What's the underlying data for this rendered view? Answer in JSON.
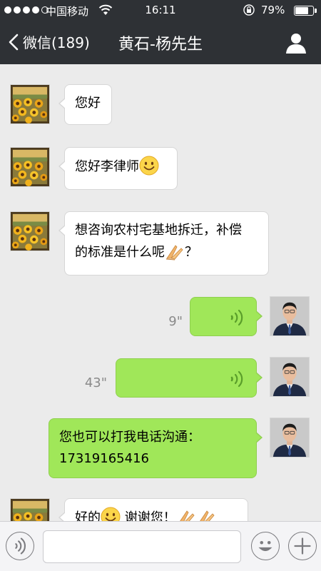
{
  "status_bar": {
    "carrier": "中国移动",
    "time": "16:11",
    "battery_percent": "79%",
    "battery_level": 0.79,
    "signal_bars": 4,
    "signal_total": 5
  },
  "nav": {
    "back_label": "微信(189)",
    "title": "黄石-杨先生"
  },
  "messages": [
    {
      "side": "left",
      "type": "text",
      "text": "您好"
    },
    {
      "side": "left",
      "type": "text",
      "text": "您好李律师",
      "emoji": "smile"
    },
    {
      "side": "left",
      "type": "text",
      "line1": "想咨询农村宅基地拆迁，补偿",
      "line2_a": "的标准是什么呢",
      "line2_b": "？",
      "emoji": "praying-hands"
    },
    {
      "side": "right",
      "type": "voice",
      "duration": "9\""
    },
    {
      "side": "right",
      "type": "voice",
      "duration": "43\""
    },
    {
      "side": "right",
      "type": "text",
      "line1": "您也可以打我电话沟通：",
      "line2": "17319165416"
    },
    {
      "side": "left",
      "type": "text",
      "text_a": "好的",
      "text_b": "谢谢您！",
      "emoji": "smile"
    }
  ],
  "input": {
    "placeholder": ""
  },
  "colors": {
    "nav_bg": "#2e3135",
    "chat_bg": "#ebebeb",
    "outgoing_bubble": "#a0e759",
    "incoming_bubble": "#ffffff",
    "voice_wave": "#5a9e2a"
  },
  "icons": {
    "back": "chevron-left-icon",
    "profile": "person-icon",
    "voice_toggle": "voice-icon",
    "emoji_btn": "smiley-icon",
    "plus": "plus-icon"
  }
}
